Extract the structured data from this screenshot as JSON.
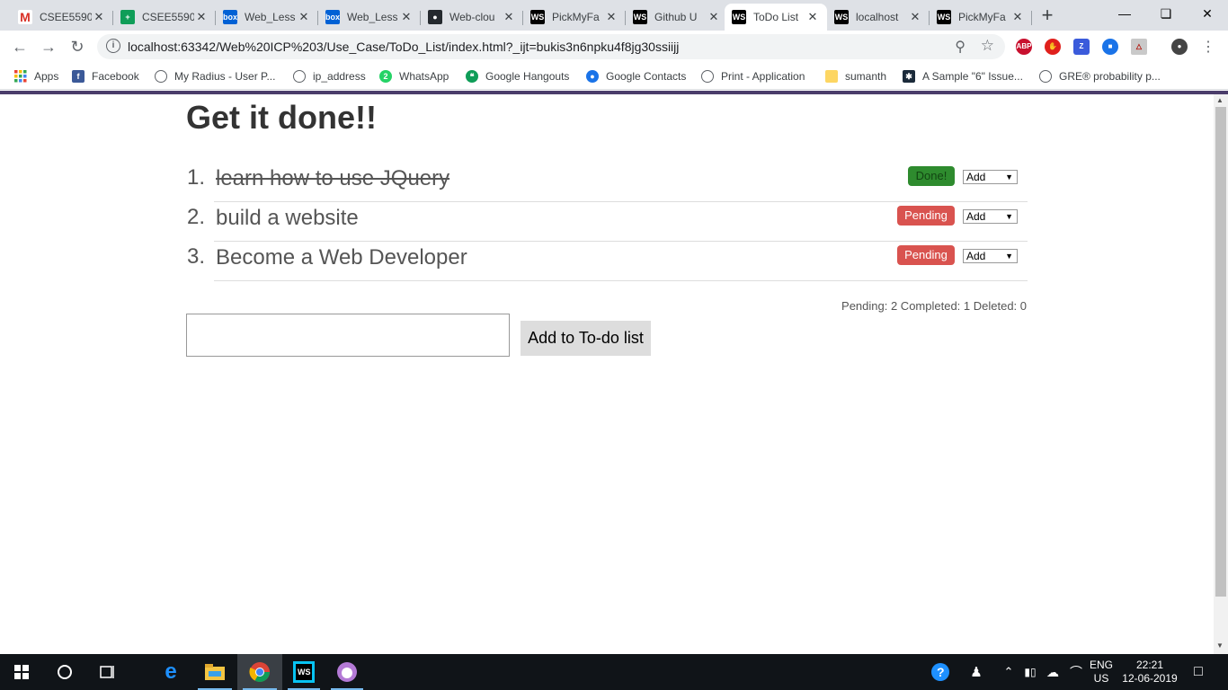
{
  "browser": {
    "tabs": [
      {
        "title": "CSEE5590",
        "icon": "gmail-icon",
        "color": "#d93025",
        "glyph": "M"
      },
      {
        "title": "CSEE5590",
        "icon": "sheets-icon",
        "color": "#0f9d58",
        "glyph": "+"
      },
      {
        "title": "Web_Less",
        "icon": "box-icon",
        "color": "#0061d5",
        "glyph": "box"
      },
      {
        "title": "Web_Less",
        "icon": "box-icon",
        "color": "#0061d5",
        "glyph": "box"
      },
      {
        "title": "Web-clou",
        "icon": "github-icon",
        "color": "#24292e",
        "glyph": "●"
      },
      {
        "title": "PickMyFa",
        "icon": "webstorm-icon",
        "color": "#000000",
        "glyph": "WS"
      },
      {
        "title": "Github U",
        "icon": "webstorm-icon",
        "color": "#000000",
        "glyph": "WS"
      },
      {
        "title": "ToDo List",
        "icon": "webstorm-icon",
        "color": "#000000",
        "glyph": "WS",
        "active": true
      },
      {
        "title": "localhost",
        "icon": "webstorm-icon",
        "color": "#000000",
        "glyph": "WS"
      },
      {
        "title": "PickMyFa",
        "icon": "webstorm-icon",
        "color": "#000000",
        "glyph": "WS"
      }
    ],
    "url": "localhost:63342/Web%20ICP%203/Use_Case/ToDo_List/index.html?_ijt=bukis3n6npku4f8jg30ssiijj",
    "bookmarks": [
      {
        "label": "Apps",
        "icon": "apps-grid-icon",
        "color": "#4285f4"
      },
      {
        "label": "Facebook",
        "icon": "facebook-icon",
        "color": "#3b5998",
        "glyph": "f"
      },
      {
        "label": "My Radius - User P...",
        "icon": "globe-icon",
        "color": "#5f6368",
        "glyph": "◐"
      },
      {
        "label": "ip_address",
        "icon": "globe-icon",
        "color": "#5f6368",
        "glyph": "◐"
      },
      {
        "label": "WhatsApp",
        "icon": "whatsapp-icon",
        "color": "#25d366",
        "glyph": "2"
      },
      {
        "label": "Google Hangouts",
        "icon": "hangouts-icon",
        "color": "#0f9d58",
        "glyph": "❝"
      },
      {
        "label": "Google Contacts",
        "icon": "contacts-icon",
        "color": "#1a73e8",
        "glyph": "●"
      },
      {
        "label": "Print - Application",
        "icon": "globe-icon",
        "color": "#5f6368",
        "glyph": "◐"
      },
      {
        "label": "sumanth",
        "icon": "folder-icon",
        "color": "#fdd663",
        "glyph": ""
      },
      {
        "label": "A Sample \"6\" Issue...",
        "icon": "snowflake-icon",
        "color": "#1b2a3a",
        "glyph": "✱"
      },
      {
        "label": "GRE® probability p...",
        "icon": "globe-icon",
        "color": "#5f6368",
        "glyph": "◐"
      }
    ]
  },
  "app": {
    "heading": "Get it done!!",
    "todos": [
      {
        "num": "1.",
        "text": "learn how to use JQuery",
        "status": "Done!",
        "done": true,
        "select": "Add"
      },
      {
        "num": "2.",
        "text": "build a website",
        "status": "Pending",
        "done": false,
        "select": "Add"
      },
      {
        "num": "3.",
        "text": "Become a Web Developer",
        "status": "Pending",
        "done": false,
        "select": "Add"
      }
    ],
    "counts": "Pending: 2 Completed: 1 Deleted: 0",
    "input_value": "",
    "add_button": "Add to To-do list"
  },
  "taskbar": {
    "lang": "ENG",
    "region": "US",
    "time": "22:21",
    "date": "12-06-2019"
  }
}
